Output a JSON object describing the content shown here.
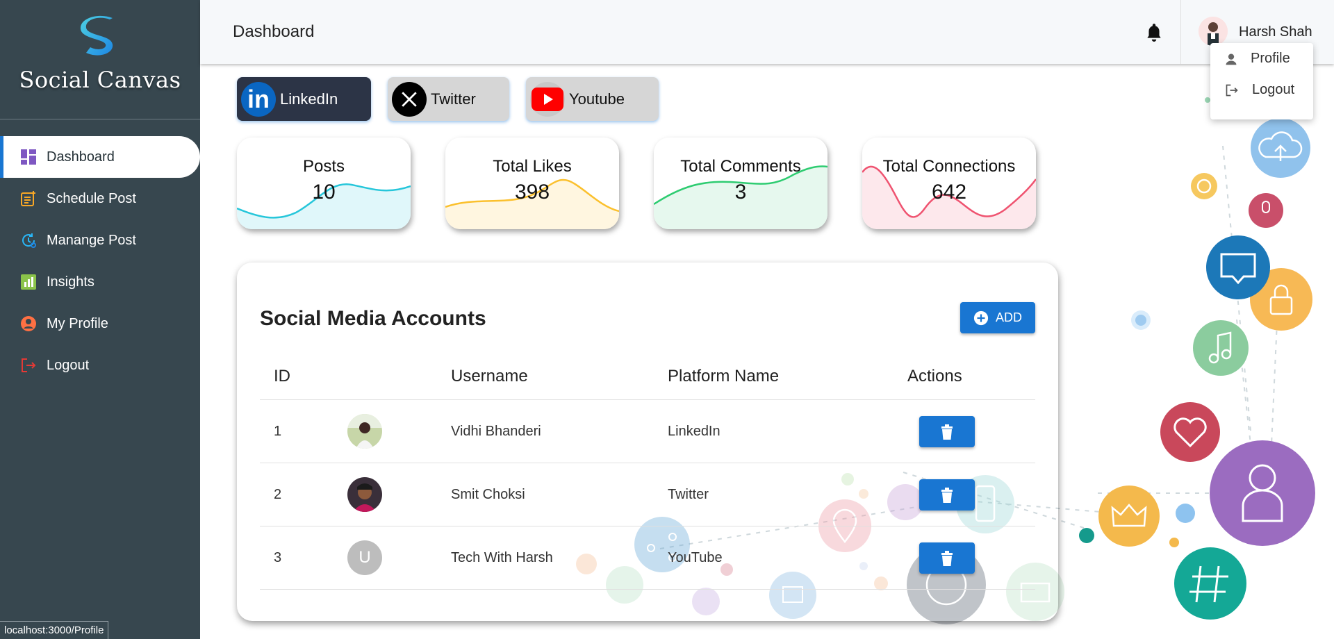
{
  "brand": {
    "name": "Social Canvas"
  },
  "sidebar": {
    "items": [
      {
        "label": "Dashboard",
        "icon": "dashboard-icon",
        "color": "#7e57c2",
        "active": true
      },
      {
        "label": "Schedule Post",
        "icon": "schedule-post-icon",
        "color": "#f9a825"
      },
      {
        "label": "Manange Post",
        "icon": "manage-post-icon",
        "color": "#29b6f6"
      },
      {
        "label": "Insights",
        "icon": "insights-icon",
        "color": "#8bc34a"
      },
      {
        "label": "My Profile",
        "icon": "account-circle-icon",
        "color": "#ff7043"
      },
      {
        "label": "Logout",
        "icon": "logout-icon",
        "color": "#e53935"
      }
    ]
  },
  "header": {
    "title": "Dashboard",
    "user_name": "Harsh Shah"
  },
  "user_menu": {
    "items": [
      {
        "label": "Profile",
        "icon": "person-icon"
      },
      {
        "label": "Logout",
        "icon": "logout-icon"
      }
    ]
  },
  "platform_tabs": [
    {
      "label": "LinkedIn",
      "icon": "linkedin-icon",
      "selected": true
    },
    {
      "label": "Twitter",
      "icon": "x-twitter-icon",
      "selected": false
    },
    {
      "label": "Youtube",
      "icon": "youtube-icon",
      "selected": false
    }
  ],
  "stats": [
    {
      "label": "Posts",
      "value": "10",
      "color": "#26c6da"
    },
    {
      "label": "Total Likes",
      "value": "398",
      "color": "#fbc02d"
    },
    {
      "label": "Total Comments",
      "value": "3",
      "color": "#2ecc71"
    },
    {
      "label": "Total Connections",
      "value": "642",
      "color": "#ef5370"
    }
  ],
  "accounts": {
    "title": "Social Media Accounts",
    "add_label": "ADD",
    "columns": [
      "ID",
      "Username",
      "Platform Name",
      "Actions"
    ],
    "rows": [
      {
        "id": "1",
        "username": "Vidhi Bhanderi",
        "platform": "LinkedIn",
        "avatar": ""
      },
      {
        "id": "2",
        "username": "Smit Choksi",
        "platform": "Twitter",
        "avatar": ""
      },
      {
        "id": "3",
        "username": "Tech With Harsh",
        "platform": "YouTube",
        "avatar": "U"
      }
    ]
  },
  "status_bar": {
    "url": "localhost:3000/Profile"
  },
  "colors": {
    "sidebar": "#37474f",
    "accent": "#1976d2"
  }
}
